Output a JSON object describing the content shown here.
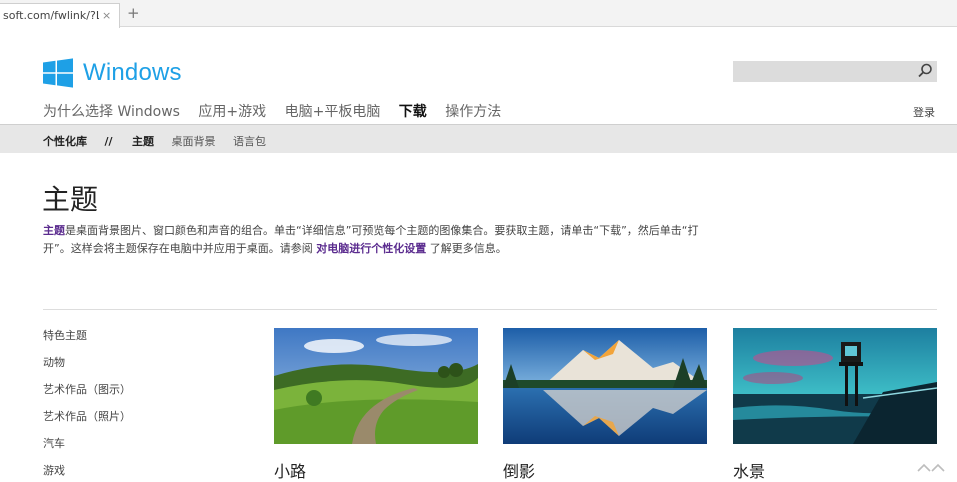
{
  "browser": {
    "tab_title": "soft.com/fwlink/?Lir",
    "tab_close": "×",
    "new_tab": "+"
  },
  "header": {
    "logo_text": "Windows",
    "search_placeholder": "",
    "signin": "登录"
  },
  "main_nav": [
    {
      "label": "为什么选择 Windows",
      "active": false
    },
    {
      "label": "应用+游戏",
      "active": false
    },
    {
      "label": "电脑+平板电脑",
      "active": false
    },
    {
      "label": "下载",
      "active": true
    },
    {
      "label": "操作方法",
      "active": false
    }
  ],
  "sub_nav": {
    "library": "个性化库",
    "separator": "//",
    "current": "主题",
    "wallpapers": "桌面背景",
    "language": "语言包"
  },
  "page": {
    "title": "主题",
    "intro_link1": "主题",
    "intro_text1": "是桌面背景图片、窗口颜色和声音的组合。单击“详细信息”可预览每个主题的图像集合。要获取主题，请单击“下载”，然后单击“打开”。这样会将主题保存在电脑中并应用于桌面。请参阅 ",
    "intro_link2": "对电脑进行个性化设置",
    "intro_text2": " 了解更多信息。"
  },
  "categories": [
    "特色主题",
    "动物",
    "艺术作品（图示）",
    "艺术作品（照片）",
    "汽车",
    "游戏"
  ],
  "themes": [
    {
      "name": "小路"
    },
    {
      "name": "倒影"
    },
    {
      "name": "水景"
    }
  ],
  "colors": {
    "brand": "#1ea0e6",
    "link": "#5b2c8f",
    "subnav_bg": "#e7e7e7"
  },
  "icons": {
    "logo": "windows-logo-icon",
    "search": "search-icon",
    "scroll": "scroll-top-icon"
  }
}
